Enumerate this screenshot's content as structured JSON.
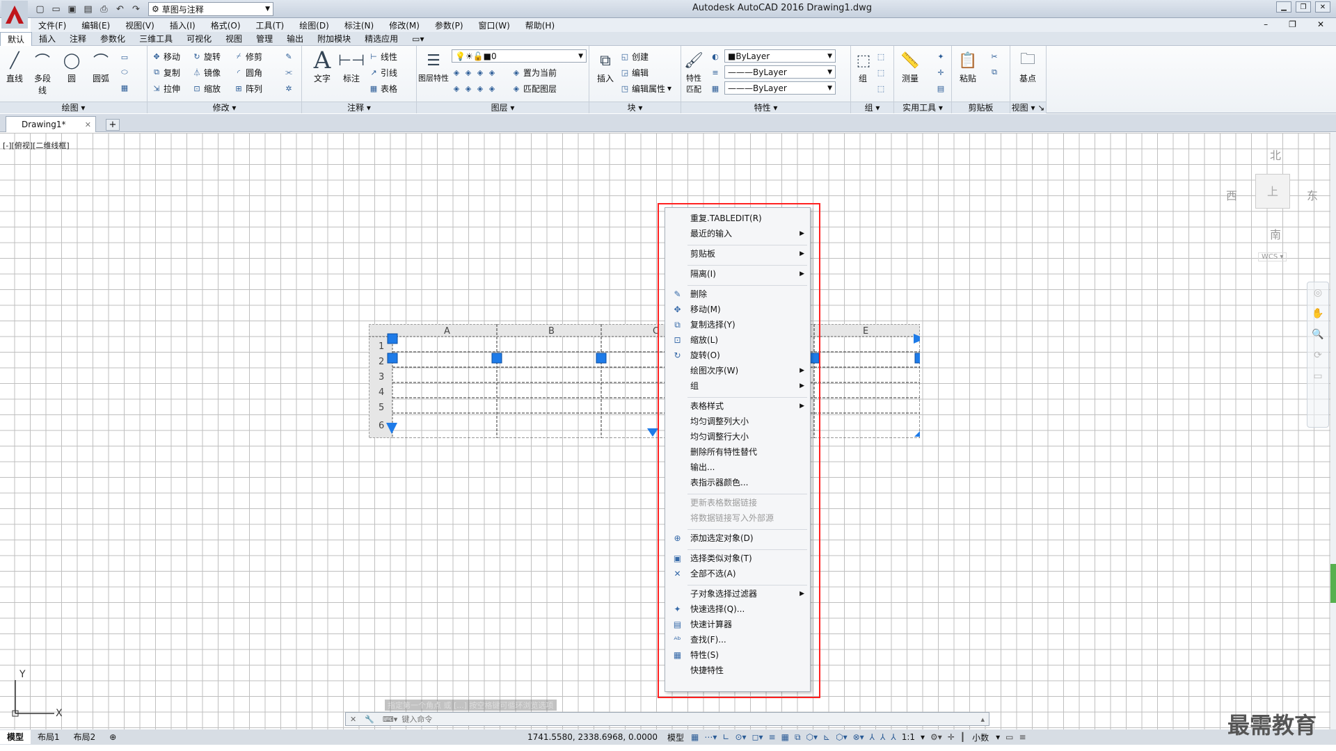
{
  "app": {
    "title": "Autodesk AutoCAD 2016    Drawing1.dwg",
    "workspace": "草图与注释",
    "logo_letter": "A"
  },
  "menubar": [
    "文件(F)",
    "编辑(E)",
    "视图(V)",
    "插入(I)",
    "格式(O)",
    "工具(T)",
    "绘图(D)",
    "标注(N)",
    "修改(M)",
    "参数(P)",
    "窗口(W)",
    "帮助(H)"
  ],
  "ribbon_tabs": [
    "默认",
    "插入",
    "注释",
    "参数化",
    "三维工具",
    "可视化",
    "视图",
    "管理",
    "输出",
    "附加模块",
    "精选应用"
  ],
  "ribbon": {
    "draw": {
      "title": "绘图",
      "line": "直线",
      "polyline": "多段线",
      "circle": "圆",
      "arc": "圆弧"
    },
    "modify": {
      "title": "修改",
      "move": "移动",
      "rotate": "旋转",
      "trim": "修剪",
      "copy": "复制",
      "mirror": "镜像",
      "fillet": "圆角",
      "stretch": "拉伸",
      "scale": "缩放",
      "array": "阵列"
    },
    "annotation": {
      "title": "注释",
      "text": "文字",
      "dimension": "标注",
      "linear": "线性",
      "leader": "引线",
      "table": "表格"
    },
    "layers": {
      "title": "图层",
      "props": "图层特性",
      "layer_value": "0",
      "set_current": "置为当前",
      "match": "匹配图层"
    },
    "block": {
      "title": "块",
      "insert": "插入",
      "create": "创建",
      "edit": "编辑",
      "edit_attr": "编辑属性"
    },
    "properties": {
      "title": "特性",
      "match": "特性匹配",
      "color": "ByLayer",
      "linetype": "ByLayer",
      "lineweight": "ByLayer"
    },
    "groups": {
      "title": "组",
      "group": "组"
    },
    "utilities": {
      "title": "实用工具",
      "measure": "测量"
    },
    "clipboard": {
      "title": "剪贴板",
      "paste": "粘贴"
    },
    "view": {
      "title": "视图",
      "base": "基点"
    }
  },
  "doc_tab": "Drawing1*",
  "viewport_label": "[-][俯视][二维线框]",
  "viewcube": {
    "north": "北",
    "south": "南",
    "east": "东",
    "west": "西",
    "wcs": "WCS"
  },
  "table": {
    "columns": [
      "A",
      "B",
      "C",
      "D",
      "E"
    ],
    "rows": [
      "1",
      "2",
      "3",
      "4",
      "5",
      "6"
    ]
  },
  "context_menu": [
    {
      "label": "重复.TABLEDIT(R)",
      "icon": "",
      "arrow": false,
      "disabled": false
    },
    {
      "label": "最近的输入",
      "icon": "",
      "arrow": true,
      "disabled": false
    },
    {
      "sep": true
    },
    {
      "label": "剪贴板",
      "icon": "",
      "arrow": true,
      "disabled": false
    },
    {
      "sep": true
    },
    {
      "label": "隔离(I)",
      "icon": "",
      "arrow": true,
      "disabled": false
    },
    {
      "sep": true
    },
    {
      "label": "删除",
      "icon": "✎",
      "arrow": false,
      "disabled": false
    },
    {
      "label": "移动(M)",
      "icon": "✥",
      "arrow": false,
      "disabled": false
    },
    {
      "label": "复制选择(Y)",
      "icon": "⧉",
      "arrow": false,
      "disabled": false
    },
    {
      "label": "缩放(L)",
      "icon": "⊡",
      "arrow": false,
      "disabled": false
    },
    {
      "label": "旋转(O)",
      "icon": "↻",
      "arrow": false,
      "disabled": false
    },
    {
      "label": "绘图次序(W)",
      "icon": "",
      "arrow": true,
      "disabled": false
    },
    {
      "label": "组",
      "icon": "",
      "arrow": true,
      "disabled": false
    },
    {
      "sep": true
    },
    {
      "label": "表格样式",
      "icon": "",
      "arrow": true,
      "disabled": false
    },
    {
      "label": "均匀调整列大小",
      "icon": "",
      "arrow": false,
      "disabled": false
    },
    {
      "label": "均匀调整行大小",
      "icon": "",
      "arrow": false,
      "disabled": false
    },
    {
      "label": "删除所有特性替代",
      "icon": "",
      "arrow": false,
      "disabled": false
    },
    {
      "label": "输出...",
      "icon": "",
      "arrow": false,
      "disabled": false
    },
    {
      "label": "表指示器颜色...",
      "icon": "",
      "arrow": false,
      "disabled": false
    },
    {
      "sep": true
    },
    {
      "label": "更新表格数据链接",
      "icon": "",
      "arrow": false,
      "disabled": true
    },
    {
      "label": "将数据链接写入外部源",
      "icon": "",
      "arrow": false,
      "disabled": true
    },
    {
      "sep": true
    },
    {
      "label": "添加选定对象(D)",
      "icon": "⊕",
      "arrow": false,
      "disabled": false
    },
    {
      "sep": true
    },
    {
      "label": "选择类似对象(T)",
      "icon": "▣",
      "arrow": false,
      "disabled": false
    },
    {
      "label": "全部不选(A)",
      "icon": "✕",
      "arrow": false,
      "disabled": false
    },
    {
      "sep": true
    },
    {
      "label": "子对象选择过滤器",
      "icon": "",
      "arrow": true,
      "disabled": false
    },
    {
      "label": "快速选择(Q)...",
      "icon": "✦",
      "arrow": false,
      "disabled": false
    },
    {
      "label": "快速计算器",
      "icon": "▤",
      "arrow": false,
      "disabled": false
    },
    {
      "label": "查找(F)...",
      "icon": "ᴬᵇ",
      "arrow": false,
      "disabled": false
    },
    {
      "label": "特性(S)",
      "icon": "▦",
      "arrow": false,
      "disabled": false
    },
    {
      "label": "快捷特性",
      "icon": "",
      "arrow": false,
      "disabled": false
    }
  ],
  "command": {
    "history": "指定第一个角点 或 [...] 按空格键可循环浏览选项",
    "placeholder": "键入命令"
  },
  "layout_tabs": [
    "模型",
    "布局1",
    "布局2"
  ],
  "status": {
    "coords": "1741.5580, 2338.6968, 0.0000",
    "model": "模型",
    "scale": "1:1",
    "units": "小数"
  },
  "ucs": {
    "x": "X",
    "y": "Y"
  },
  "watermark": "最需教育"
}
